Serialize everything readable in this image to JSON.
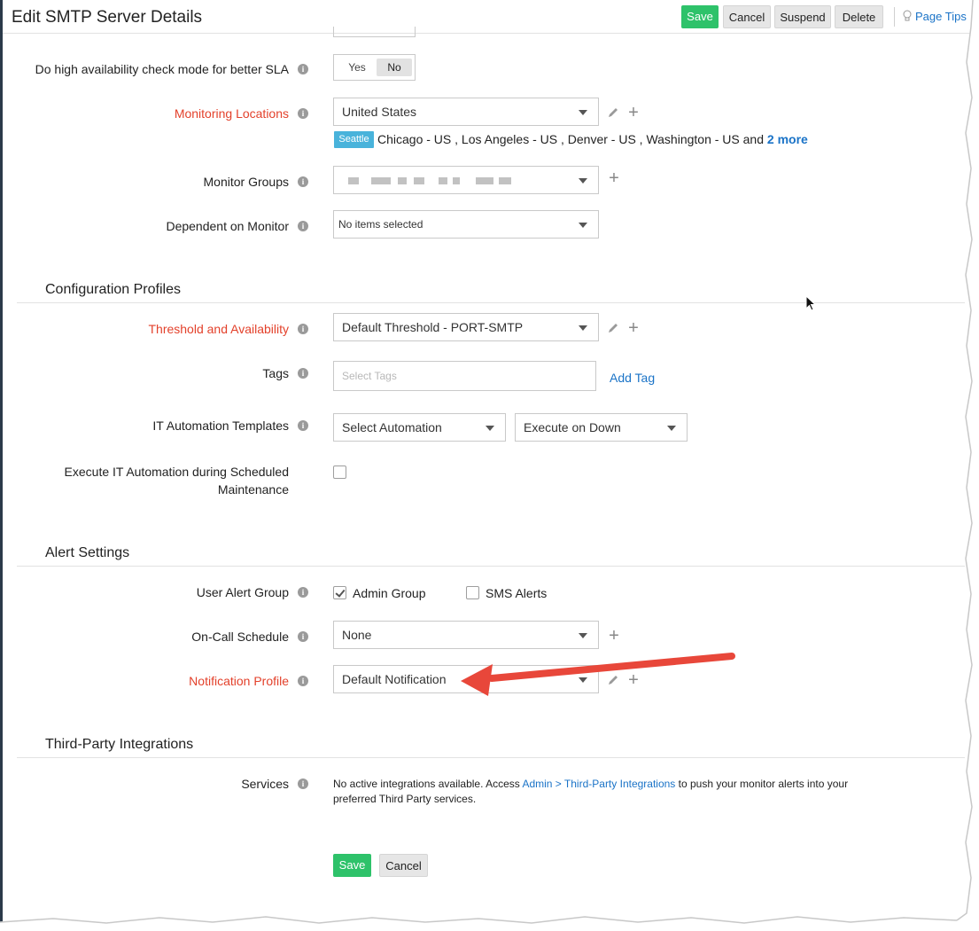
{
  "header": {
    "title": "Edit SMTP Server Details",
    "save_label": "Save",
    "cancel_label": "Cancel",
    "suspend_label": "Suspend",
    "delete_label": "Delete",
    "page_tips_label": "Page Tips"
  },
  "monitor": {
    "ha_check_label": "Do high availability check mode for better SLA",
    "ha_yes": "Yes",
    "ha_no": "No",
    "ha_selected": "No",
    "locations_label": "Monitoring Locations",
    "locations_value": "United States",
    "locations_primary_chip": "Seattle",
    "locations_secondary": "Chicago - US , Los Angeles - US , Denver - US , Washington - US and ",
    "locations_more": "2 more",
    "groups_label": "Monitor Groups",
    "dependent_label": "Dependent on Monitor",
    "dependent_value": "No items selected"
  },
  "config": {
    "section_title": "Configuration Profiles",
    "threshold_label": "Threshold and Availability",
    "threshold_value": "Default Threshold - PORT-SMTP",
    "tags_label": "Tags",
    "tags_placeholder": "Select Tags",
    "add_tag_label": "Add Tag",
    "it_automation_label": "IT Automation Templates",
    "automation_value": "Select Automation",
    "execute_value": "Execute on Down",
    "execute_maint_label_line1": "Execute IT Automation during Scheduled",
    "execute_maint_label_line2": "Maintenance",
    "execute_maint_checked": false
  },
  "alerts": {
    "section_title": "Alert Settings",
    "user_alert_group_label": "User Alert Group",
    "admin_group_label": "Admin Group",
    "admin_group_checked": true,
    "sms_alerts_label": "SMS Alerts",
    "sms_alerts_checked": false,
    "oncall_label": "On-Call Schedule",
    "oncall_value": "None",
    "notification_label": "Notification Profile",
    "notification_value": "Default Notification"
  },
  "integrations": {
    "section_title": "Third-Party Integrations",
    "services_label": "Services",
    "services_text_before": "No active integrations available. Access ",
    "services_link": "Admin > Third-Party Integrations",
    "services_text_after": " to push your monitor alerts into your preferred Third Party services."
  },
  "footer": {
    "save_label": "Save",
    "cancel_label": "Cancel"
  },
  "colors": {
    "required_label": "#e3412b",
    "save_green": "#2ec26a",
    "link_blue": "#1a73c7",
    "location_chip": "#49b3db",
    "annotation_arrow": "#e8473a"
  },
  "icons": [
    "info-icon",
    "dropdown-caret-icon",
    "edit-pencil-icon",
    "add-plus-icon",
    "lightbulb-icon",
    "check-icon",
    "mouse-cursor-icon",
    "annotation-arrow"
  ]
}
